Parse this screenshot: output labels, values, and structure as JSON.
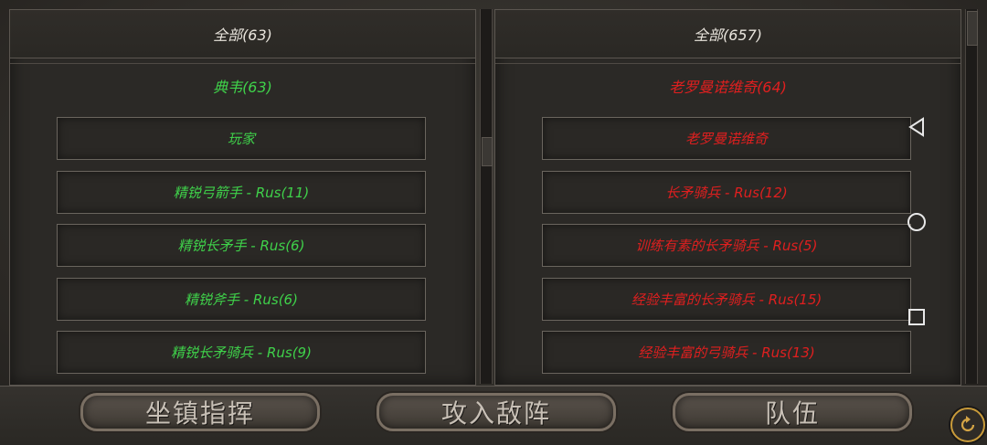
{
  "left_panel": {
    "header": "全部(63)",
    "group_title": "典韦(63)",
    "rows": [
      "玩家",
      "精锐弓箭手 - Rus(11)",
      "精锐长矛手 - Rus(6)",
      "精锐斧手 - Rus(6)",
      "精锐长矛骑兵 - Rus(9)"
    ]
  },
  "right_panel": {
    "header": "全部(657)",
    "group_title": "老罗曼诺维奇(64)",
    "rows": [
      "老罗曼诺维奇",
      "长矛骑兵 - Rus(12)",
      "训练有素的长矛骑兵 - Rus(5)",
      "经验丰富的长矛骑兵 - Rus(15)",
      "经验丰富的弓骑兵 - Rus(13)"
    ]
  },
  "buttons": {
    "hold": "坐镇指挥",
    "attack": "攻入敌阵",
    "troops": "队伍"
  },
  "colors": {
    "friendly": "#3fd14a",
    "enemy": "#e01f1f"
  },
  "icons": {
    "back": "triangle-back-icon",
    "home": "circle-home-icon",
    "recents": "square-recents-icon",
    "refresh": "refresh-icon"
  }
}
